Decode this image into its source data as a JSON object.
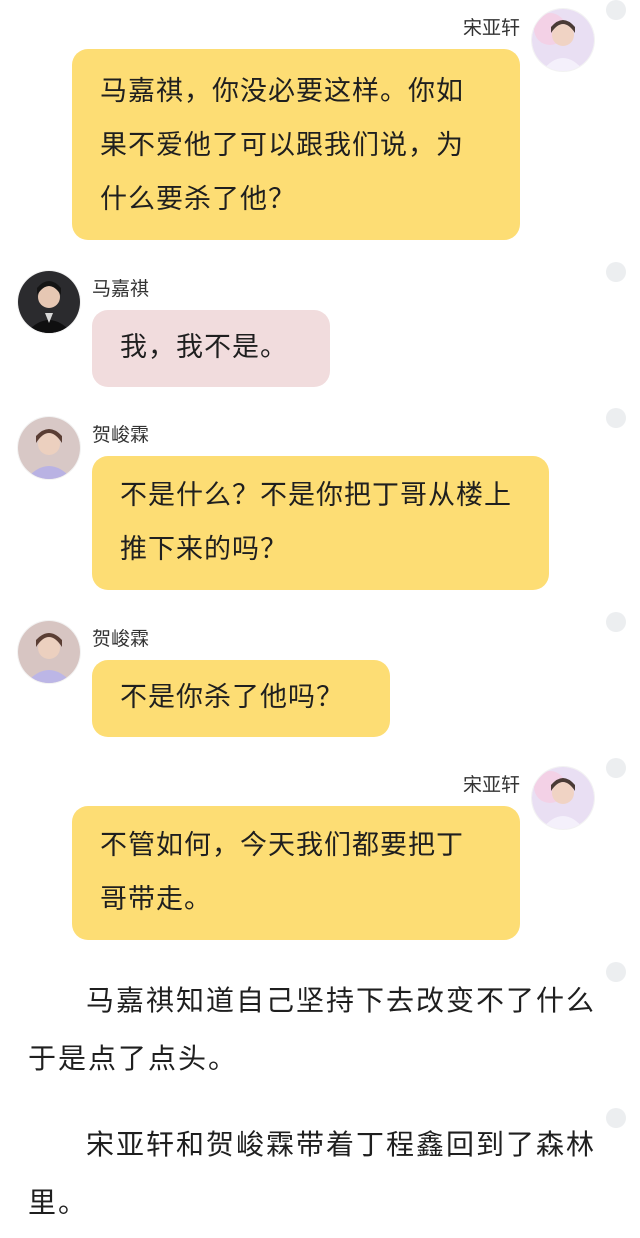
{
  "messages": [
    {
      "speaker": "宋亚轩",
      "text": "马嘉祺，你没必要这样。你如果不爱他了可以跟我们说，为什么要杀了他？",
      "avatar_icon": "avatar-song-yaxuan-icon"
    },
    {
      "speaker": "马嘉祺",
      "text": "我，我不是。",
      "avatar_icon": "avatar-ma-jiaqi-icon"
    },
    {
      "speaker": "贺峻霖",
      "text": "不是什么？不是你把丁哥从楼上推下来的吗？",
      "avatar_icon": "avatar-he-junlin-icon"
    },
    {
      "speaker": "贺峻霖",
      "text": "不是你杀了他吗？",
      "avatar_icon": "avatar-he-junlin-icon"
    },
    {
      "speaker": "宋亚轩",
      "text": "不管如何，今天我们都要把丁哥带走。",
      "avatar_icon": "avatar-song-yaxuan-icon"
    }
  ],
  "narration": [
    "马嘉祺知道自己坚持下去改变不了什么于是点了点头。",
    "宋亚轩和贺峻霖带着丁程鑫回到了森林里。"
  ],
  "colors": {
    "bubble_yellow": "#fddd74",
    "bubble_pink": "#f1dcdd",
    "side_dot": "#eceef0"
  }
}
